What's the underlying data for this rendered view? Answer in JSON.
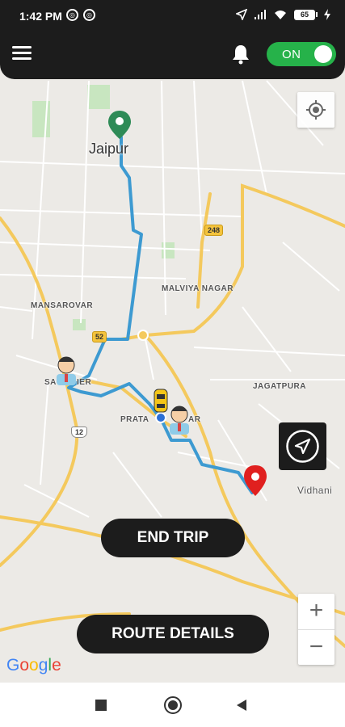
{
  "status_bar": {
    "time": "1:42 PM",
    "battery": "65"
  },
  "header": {
    "toggle_label": "ON"
  },
  "map": {
    "city_label": "Jaipur",
    "areas": [
      "MALVIYA NAGAR",
      "MANSAROVAR",
      "JAGATPURA",
      "SA",
      "IER",
      "PRATA",
      "AR"
    ],
    "place_label": "Vidhani",
    "road_shields": [
      "248",
      "52",
      "12"
    ]
  },
  "actions": {
    "end_trip_label": "END TRIP",
    "route_details_label": "ROUTE DETAILS"
  },
  "zoom": {
    "in_label": "+",
    "out_label": "−"
  },
  "attribution": {
    "letters": [
      "G",
      "o",
      "o",
      "g",
      "l",
      "e"
    ]
  },
  "colors": {
    "header_bg": "#1c1c1c",
    "toggle_on": "#26b24a",
    "route": "#3d9ad1",
    "start_pin": "#2e8b57",
    "end_pin": "#e0201f",
    "road_major": "#f4c95d"
  },
  "icons": {
    "menu": "menu-icon",
    "notifications": "bell-icon",
    "my_location": "my-location-icon",
    "navigate": "navigation-arrow-icon"
  }
}
